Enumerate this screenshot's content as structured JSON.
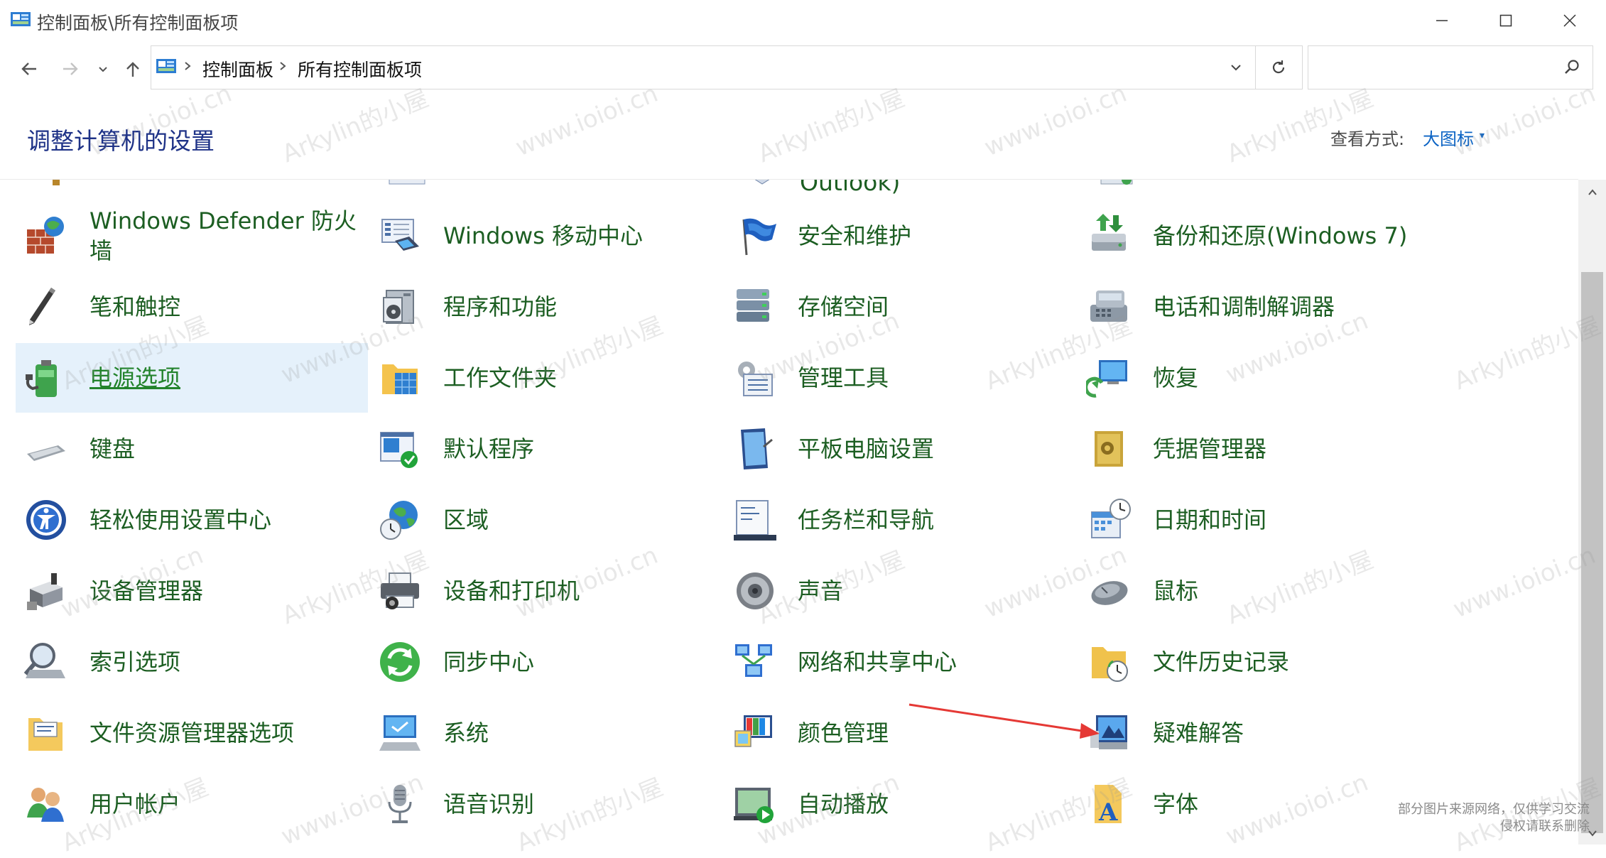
{
  "window": {
    "title": "控制面板\\所有控制面板项",
    "controls": [
      "minimize",
      "maximize",
      "close"
    ]
  },
  "nav": {
    "breadcrumb": [
      "控制面板",
      "所有控制面板项"
    ],
    "search_placeholder": ""
  },
  "header": {
    "title": "调整计算机的设置",
    "view_by_label": "查看方式:",
    "view_by_value": "大图标"
  },
  "partial_row": [
    "Outlook)"
  ],
  "items": [
    {
      "label": "Windows Defender 防火墙",
      "icon": "firewall-icon"
    },
    {
      "label": "Windows 移动中心",
      "icon": "mobility-center-icon"
    },
    {
      "label": "安全和维护",
      "icon": "security-flag-icon"
    },
    {
      "label": "备份和还原(Windows 7)",
      "icon": "backup-restore-icon"
    },
    {
      "label": "笔和触控",
      "icon": "pen-icon"
    },
    {
      "label": "程序和功能",
      "icon": "programs-icon"
    },
    {
      "label": "存储空间",
      "icon": "storage-spaces-icon"
    },
    {
      "label": "电话和调制解调器",
      "icon": "phone-modem-icon"
    },
    {
      "label": "电源选项",
      "icon": "power-battery-icon",
      "state": "hover"
    },
    {
      "label": "工作文件夹",
      "icon": "work-folders-icon"
    },
    {
      "label": "管理工具",
      "icon": "admin-tools-icon"
    },
    {
      "label": "恢复",
      "icon": "recovery-icon"
    },
    {
      "label": "键盘",
      "icon": "keyboard-icon"
    },
    {
      "label": "默认程序",
      "icon": "default-programs-icon"
    },
    {
      "label": "平板电脑设置",
      "icon": "tablet-icon"
    },
    {
      "label": "凭据管理器",
      "icon": "credential-vault-icon"
    },
    {
      "label": "轻松使用设置中心",
      "icon": "ease-of-access-icon"
    },
    {
      "label": "区域",
      "icon": "region-globe-icon"
    },
    {
      "label": "任务栏和导航",
      "icon": "taskbar-icon"
    },
    {
      "label": "日期和时间",
      "icon": "date-time-icon"
    },
    {
      "label": "设备管理器",
      "icon": "device-manager-icon"
    },
    {
      "label": "设备和打印机",
      "icon": "printer-icon"
    },
    {
      "label": "声音",
      "icon": "speaker-icon"
    },
    {
      "label": "鼠标",
      "icon": "mouse-icon"
    },
    {
      "label": "索引选项",
      "icon": "indexing-icon"
    },
    {
      "label": "同步中心",
      "icon": "sync-center-icon"
    },
    {
      "label": "网络和共享中心",
      "icon": "network-icon"
    },
    {
      "label": "文件历史记录",
      "icon": "file-history-icon"
    },
    {
      "label": "文件资源管理器选项",
      "icon": "folder-options-icon"
    },
    {
      "label": "系统",
      "icon": "system-computer-icon"
    },
    {
      "label": "颜色管理",
      "icon": "color-management-icon"
    },
    {
      "label": "疑难解答",
      "icon": "troubleshooting-icon"
    },
    {
      "label": "用户帐户",
      "icon": "user-accounts-icon"
    },
    {
      "label": "语音识别",
      "icon": "microphone-icon"
    },
    {
      "label": "自动播放",
      "icon": "autoplay-icon"
    },
    {
      "label": "字体",
      "icon": "fonts-icon"
    }
  ],
  "annotation": {
    "arrow_color": "#e53935"
  },
  "footer_note": [
    "部分图片来源网络，仅供学习交流",
    "侵权请联系删除"
  ],
  "watermarks": [
    "www.ioioi.cn",
    "Arkylin的小屋"
  ],
  "colors": {
    "item_text": "#1c5e22",
    "title": "#1e3287",
    "link": "#0b63c4",
    "hover": "#e5f1fb"
  }
}
